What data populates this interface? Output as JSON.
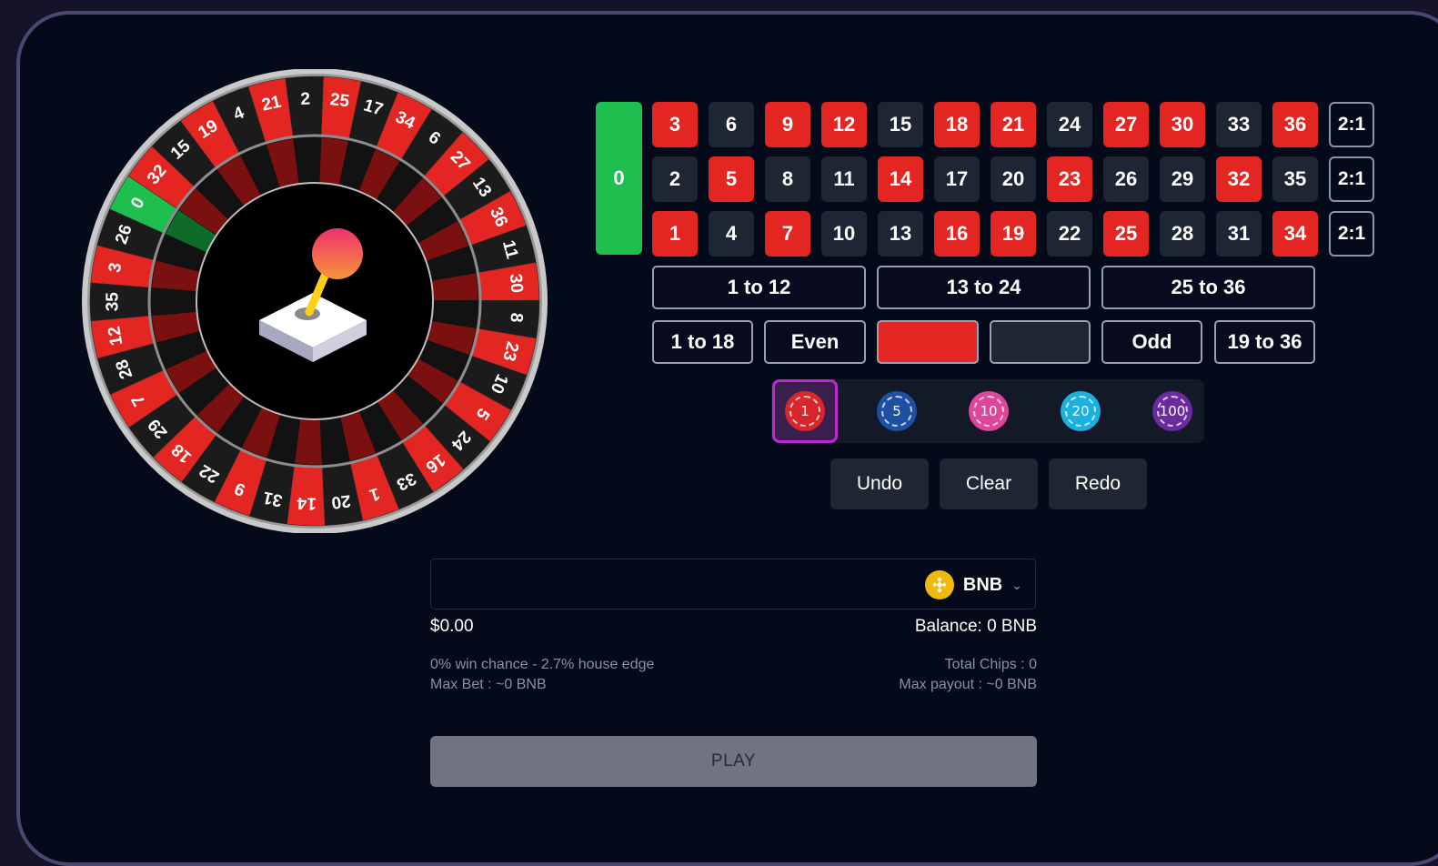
{
  "wheel": {
    "pockets": [
      {
        "n": "0",
        "color": "green"
      },
      {
        "n": "32",
        "color": "red"
      },
      {
        "n": "15",
        "color": "black"
      },
      {
        "n": "19",
        "color": "red"
      },
      {
        "n": "4",
        "color": "black"
      },
      {
        "n": "21",
        "color": "red"
      },
      {
        "n": "2",
        "color": "black"
      },
      {
        "n": "25",
        "color": "red"
      },
      {
        "n": "17",
        "color": "black"
      },
      {
        "n": "34",
        "color": "red"
      },
      {
        "n": "6",
        "color": "black"
      },
      {
        "n": "27",
        "color": "red"
      },
      {
        "n": "13",
        "color": "black"
      },
      {
        "n": "36",
        "color": "red"
      },
      {
        "n": "11",
        "color": "black"
      },
      {
        "n": "30",
        "color": "red"
      },
      {
        "n": "8",
        "color": "black"
      },
      {
        "n": "23",
        "color": "red"
      },
      {
        "n": "10",
        "color": "black"
      },
      {
        "n": "5",
        "color": "red"
      },
      {
        "n": "24",
        "color": "black"
      },
      {
        "n": "16",
        "color": "red"
      },
      {
        "n": "33",
        "color": "black"
      },
      {
        "n": "1",
        "color": "red"
      },
      {
        "n": "20",
        "color": "black"
      },
      {
        "n": "14",
        "color": "red"
      },
      {
        "n": "31",
        "color": "black"
      },
      {
        "n": "9",
        "color": "red"
      },
      {
        "n": "22",
        "color": "black"
      },
      {
        "n": "18",
        "color": "red"
      },
      {
        "n": "29",
        "color": "black"
      },
      {
        "n": "7",
        "color": "red"
      },
      {
        "n": "28",
        "color": "black"
      },
      {
        "n": "12",
        "color": "red"
      },
      {
        "n": "35",
        "color": "black"
      },
      {
        "n": "3",
        "color": "red"
      },
      {
        "n": "26",
        "color": "black"
      }
    ],
    "center_icon": "joystick-icon"
  },
  "board": {
    "zero": "0",
    "rows": [
      [
        {
          "n": "3",
          "c": "red"
        },
        {
          "n": "6",
          "c": "black"
        },
        {
          "n": "9",
          "c": "red"
        },
        {
          "n": "12",
          "c": "red"
        },
        {
          "n": "15",
          "c": "black"
        },
        {
          "n": "18",
          "c": "red"
        },
        {
          "n": "21",
          "c": "red"
        },
        {
          "n": "24",
          "c": "black"
        },
        {
          "n": "27",
          "c": "red"
        },
        {
          "n": "30",
          "c": "red"
        },
        {
          "n": "33",
          "c": "black"
        },
        {
          "n": "36",
          "c": "red"
        }
      ],
      [
        {
          "n": "2",
          "c": "black"
        },
        {
          "n": "5",
          "c": "red"
        },
        {
          "n": "8",
          "c": "black"
        },
        {
          "n": "11",
          "c": "black"
        },
        {
          "n": "14",
          "c": "red"
        },
        {
          "n": "17",
          "c": "black"
        },
        {
          "n": "20",
          "c": "black"
        },
        {
          "n": "23",
          "c": "red"
        },
        {
          "n": "26",
          "c": "black"
        },
        {
          "n": "29",
          "c": "black"
        },
        {
          "n": "32",
          "c": "red"
        },
        {
          "n": "35",
          "c": "black"
        }
      ],
      [
        {
          "n": "1",
          "c": "red"
        },
        {
          "n": "4",
          "c": "black"
        },
        {
          "n": "7",
          "c": "red"
        },
        {
          "n": "10",
          "c": "black"
        },
        {
          "n": "13",
          "c": "black"
        },
        {
          "n": "16",
          "c": "red"
        },
        {
          "n": "19",
          "c": "red"
        },
        {
          "n": "22",
          "c": "black"
        },
        {
          "n": "25",
          "c": "red"
        },
        {
          "n": "28",
          "c": "black"
        },
        {
          "n": "31",
          "c": "black"
        },
        {
          "n": "34",
          "c": "red"
        }
      ]
    ],
    "column_bets": [
      "2:1",
      "2:1",
      "2:1"
    ],
    "dozens": [
      "1 to 12",
      "13 to 24",
      "25 to 36"
    ],
    "low": "1 to 18",
    "even": "Even",
    "odd": "Odd",
    "high": "19 to 36"
  },
  "chips": [
    {
      "value": "1",
      "color": "#d9262c",
      "selected": true
    },
    {
      "value": "5",
      "color": "#1d4fa3",
      "selected": false
    },
    {
      "value": "10",
      "color": "#e0449b",
      "selected": false
    },
    {
      "value": "20",
      "color": "#1ab1e0",
      "selected": false
    },
    {
      "value": "100",
      "color": "#6a2b9e",
      "selected": false
    }
  ],
  "controls": {
    "undo": "Undo",
    "clear": "Clear",
    "redo": "Redo"
  },
  "bet": {
    "amount": "",
    "currency": "BNB",
    "currency_icon": "bnb-coin-icon",
    "usd_value": "$0.00",
    "balance": "Balance: 0 BNB",
    "win_chance": "0% win chance - 2.7% house edge",
    "max_bet": "Max Bet : ~0 BNB",
    "total_chips": "Total Chips : 0",
    "max_payout": "Max payout : ~0 BNB"
  },
  "play": {
    "label": "PLAY"
  },
  "colors": {
    "red": "#e42623",
    "black": "#1e2633",
    "green": "#1fbf4f",
    "background": "#050a1a"
  }
}
